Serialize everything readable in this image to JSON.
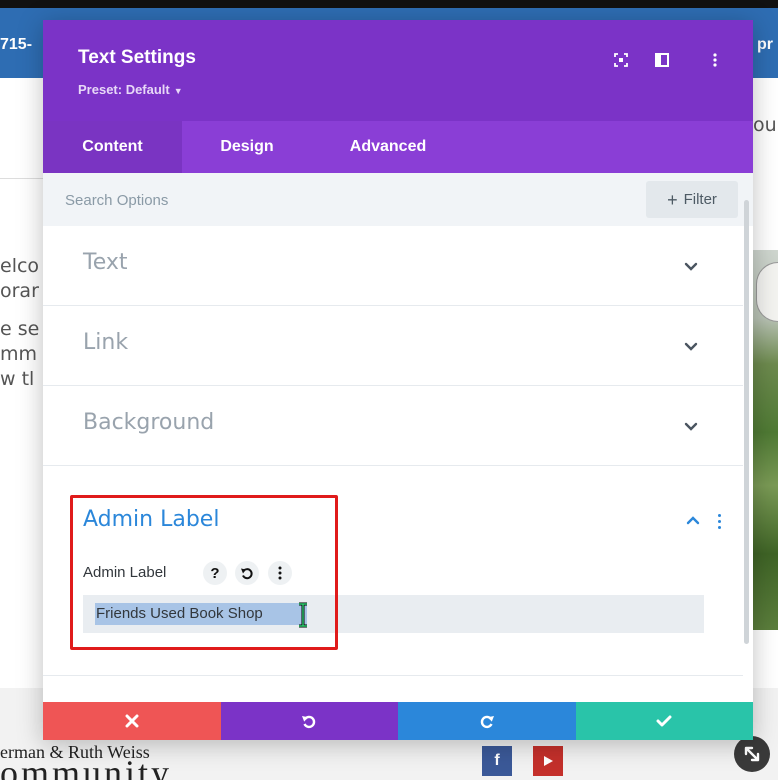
{
  "background_page": {
    "strip_left_text": "715-",
    "strip_right_text": "pr",
    "right_text_fragment": "ou",
    "left_text_lines": [
      "elco",
      "orar",
      "e se",
      "mm",
      "w tl"
    ],
    "footer_name_fragment": "erman & Ruth Weiss",
    "footer_word_fragment": "ommunity",
    "social_icons": [
      "facebook-icon",
      "youtube-icon"
    ]
  },
  "modal": {
    "title": "Text Settings",
    "preset": "Preset: Default",
    "header_icons": [
      "expand-icon",
      "split-view-icon",
      "more-vertical-icon"
    ],
    "tabs": [
      {
        "label": "Content",
        "active": true
      },
      {
        "label": "Design",
        "active": false
      },
      {
        "label": "Advanced",
        "active": false
      }
    ],
    "search": {
      "placeholder": "Search Options",
      "filter_label": "Filter"
    },
    "sections": [
      {
        "label": "Text",
        "expanded": false
      },
      {
        "label": "Link",
        "expanded": false
      },
      {
        "label": "Background",
        "expanded": false
      },
      {
        "label": "Admin Label",
        "expanded": true
      }
    ],
    "admin_label": {
      "field_label": "Admin Label",
      "value": "Friends Used Book Shop",
      "help_button": "?"
    },
    "footer_buttons": [
      "discard",
      "undo",
      "redo",
      "save"
    ]
  },
  "colors": {
    "header": "#7b33c7",
    "tabs": "#8a3ed6",
    "accent_blue": "#2b87da",
    "discard": "#ef5555",
    "save": "#29c4a9",
    "highlight_box": "#e01b1b"
  }
}
